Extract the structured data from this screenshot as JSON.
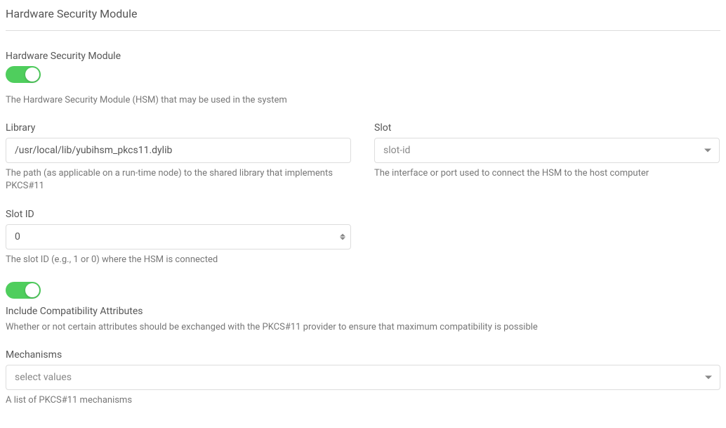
{
  "page": {
    "title": "Hardware Security Module"
  },
  "hsm_toggle": {
    "label": "Hardware Security Module",
    "enabled": true,
    "help": "The Hardware Security Module (HSM) that may be used in the system"
  },
  "library": {
    "label": "Library",
    "value": "/usr/local/lib/yubihsm_pkcs11.dylib",
    "help": "The path (as applicable on a run-time node) to the shared library that implements PKCS#11"
  },
  "slot": {
    "label": "Slot",
    "selected": "slot-id",
    "help": "The interface or port used to connect the HSM to the host computer"
  },
  "slot_id": {
    "label": "Slot ID",
    "value": "0",
    "help": "The slot ID (e.g., 1 or 0) where the HSM is connected"
  },
  "compat": {
    "label": "Include Compatibility Attributes",
    "enabled": true,
    "help": "Whether or not certain attributes should be exchanged with the PKCS#11 provider to ensure that maximum compatibility is possible"
  },
  "mechanisms": {
    "label": "Mechanisms",
    "placeholder": "select values",
    "help": "A list of PKCS#11 mechanisms"
  }
}
